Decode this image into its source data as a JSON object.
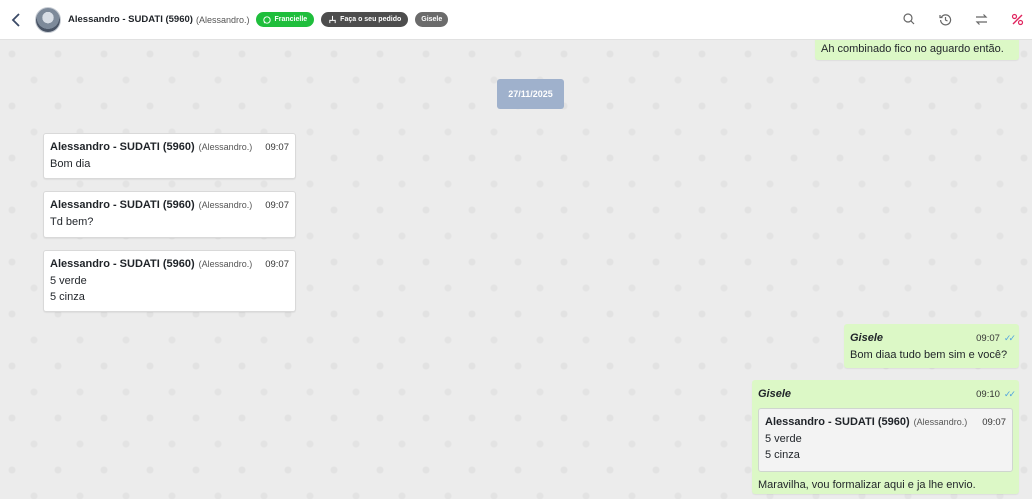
{
  "header": {
    "contact_name": "Alessandro - SUDATI (5960)",
    "contact_alias": "(Alessandro.)",
    "tags": [
      {
        "label": "Francielle",
        "color": "#1fbe3c",
        "icon": "whatsapp-icon"
      },
      {
        "label": "Faça o seu pedido",
        "color": "#4d4d4d",
        "icon": "flow-icon"
      },
      {
        "label": "Gisele",
        "color": "#6b6b6b"
      }
    ],
    "actions": [
      "search-icon",
      "history-icon",
      "transfer-icon",
      "close-ticket-icon"
    ]
  },
  "chat": {
    "date_separator": "27/11/2025",
    "messages": [
      {
        "direction": "out",
        "text": "Ah combinado fico no aguardo então."
      },
      {
        "direction": "in",
        "sender": "Alessandro - SUDATI (5960)",
        "sender_alias": "(Alessandro.)",
        "time": "09:07",
        "lines": [
          "Bom dia"
        ]
      },
      {
        "direction": "in",
        "sender": "Alessandro - SUDATI (5960)",
        "sender_alias": "(Alessandro.)",
        "time": "09:07",
        "lines": [
          "Td bem?"
        ]
      },
      {
        "direction": "in",
        "sender": "Alessandro - SUDATI (5960)",
        "sender_alias": "(Alessandro.)",
        "time": "09:07",
        "lines": [
          "5 verde",
          "5 cinza"
        ]
      },
      {
        "direction": "out",
        "sender": "Gisele",
        "time": "09:07",
        "text": "Bom diaa tudo bem sim e você?"
      },
      {
        "direction": "out",
        "sender": "Gisele",
        "time": "09:10",
        "quoted": {
          "sender": "Alessandro - SUDATI (5960)",
          "sender_alias": "(Alessandro.)",
          "time": "09:07",
          "lines": [
            "5 verde",
            "5 cinza"
          ]
        },
        "text": "Maravilha, vou formalizar aqui e ja lhe envio."
      }
    ]
  },
  "colors": {
    "accent_green": "#1fbe3c",
    "outgoing_bubble": "#dcf8c6",
    "date_pill": "#9fb1cc",
    "read_ticks": "#4fa3e0",
    "danger": "#e0245e"
  }
}
